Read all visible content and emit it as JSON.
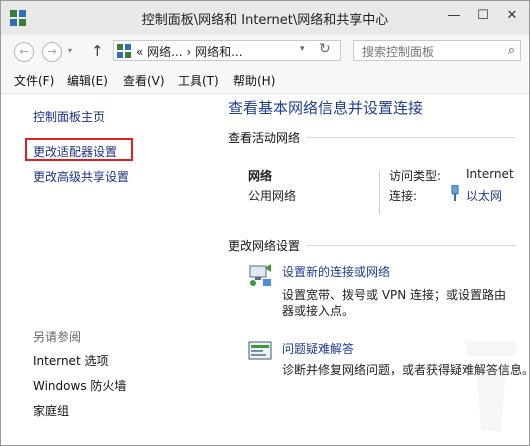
{
  "window": {
    "title": "控制面板\\网络和 Internet\\网络和共享中心",
    "minimize": "—",
    "maximize": "☐",
    "close": "✕"
  },
  "nav": {
    "back": "←",
    "forward": "→",
    "dropdown": "▾",
    "up": "↑"
  },
  "address": {
    "prefix": "«",
    "crumb1": "网络...",
    "sep": "›",
    "crumb2": "网络和...",
    "dropdown": "▾",
    "refresh": "↻"
  },
  "search": {
    "placeholder": "搜索控制面板",
    "icon": "⌕"
  },
  "menu": {
    "file": "文件(F)",
    "edit": "编辑(E)",
    "view": "查看(V)",
    "tools": "工具(T)",
    "help": "帮助(H)"
  },
  "left": {
    "home": "控制面板主页",
    "adapter": "更改适配器设置",
    "advanced": "更改高级共享设置",
    "see_also": "另请参阅",
    "related": [
      "Internet 选项",
      "Windows 防火墙",
      "家庭组"
    ]
  },
  "main": {
    "title": "查看基本网络信息并设置连接",
    "active_heading": "查看活动网络",
    "network_name": "网络",
    "network_type": "公用网络",
    "access_label": "访问类型:",
    "access_value": "Internet",
    "conn_label": "连接:",
    "conn_value": "以太网",
    "change_heading": "更改网络设置",
    "tasks": [
      {
        "title": "设置新的连接或网络",
        "desc1": "设置宽带、拨号或 VPN 连接；或设置路由",
        "desc2": "器或接入点。"
      },
      {
        "title": "问题疑难解答",
        "desc1": "诊断并修复网络问题，或者获得疑难解答信息。"
      }
    ]
  },
  "colors": {
    "link": "#1e3c96",
    "highlight": "#e02020",
    "titlebar": "#e9e9e9"
  }
}
